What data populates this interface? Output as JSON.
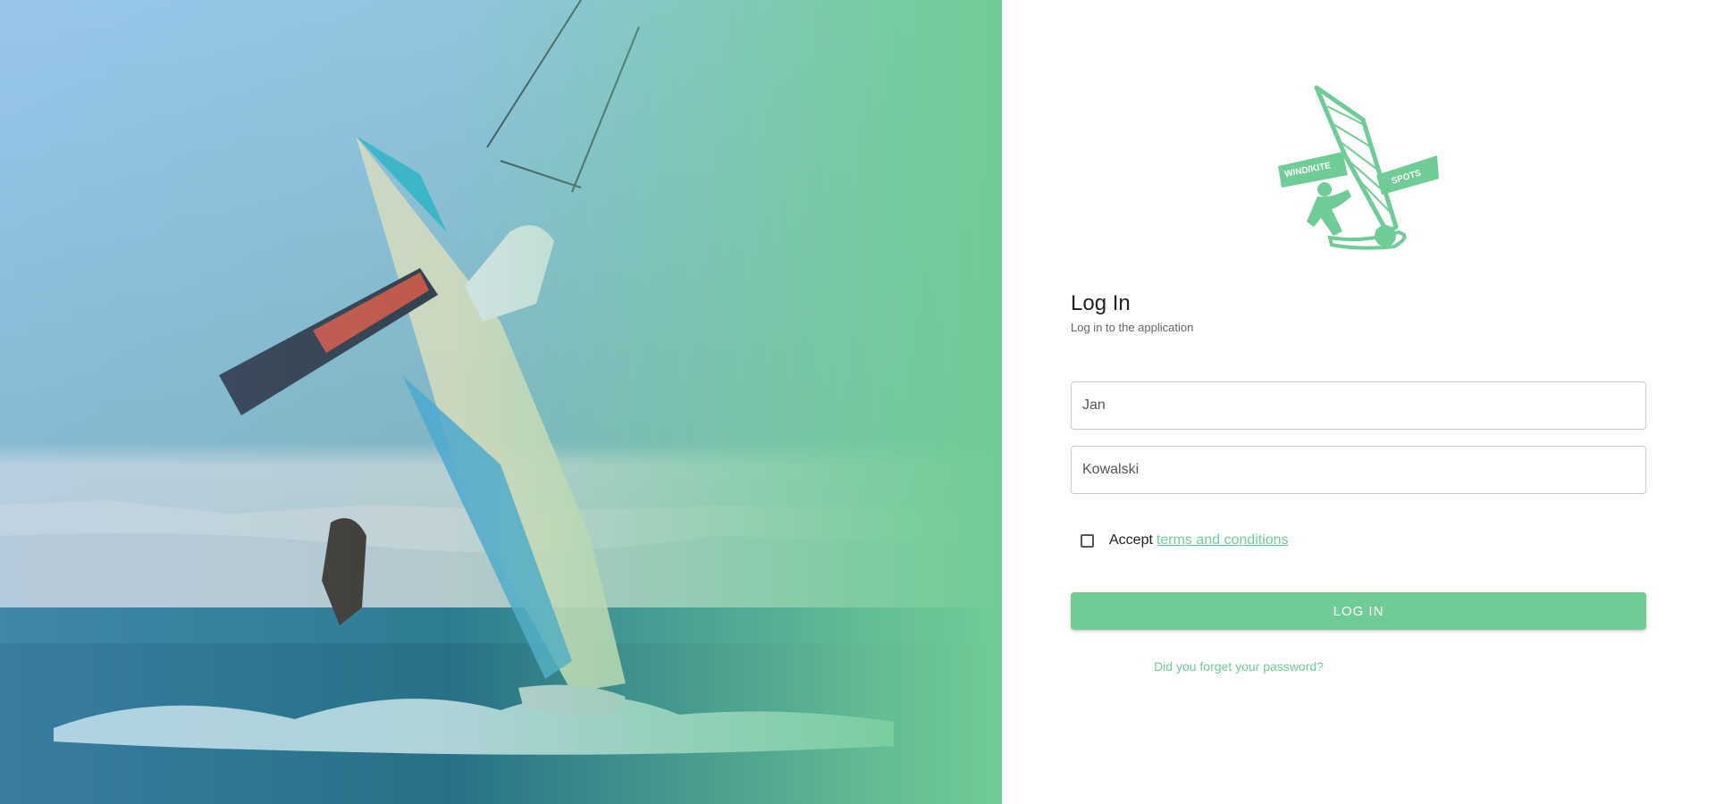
{
  "hero": {
    "image": "kitesurfer-and-windsurfer-photo",
    "overlay_colors": [
      "#8cbef0",
      "#70cc96"
    ]
  },
  "logo": {
    "icon": "windsurfer-logo-icon",
    "left_text": "WIND/KITE",
    "right_text": "SPOTS",
    "color": "#70cc96"
  },
  "login": {
    "title": "Log In",
    "subtitle": "Log in to the application",
    "first_name_value": "Jan",
    "last_name_value": "Kowalski",
    "accept_label": "Accept",
    "terms_link": "terms and conditions",
    "submit_label": "LOG IN",
    "forgot_link": "Did you forget your password?"
  },
  "colors": {
    "accent": "#70cc96",
    "text": "#222222"
  }
}
